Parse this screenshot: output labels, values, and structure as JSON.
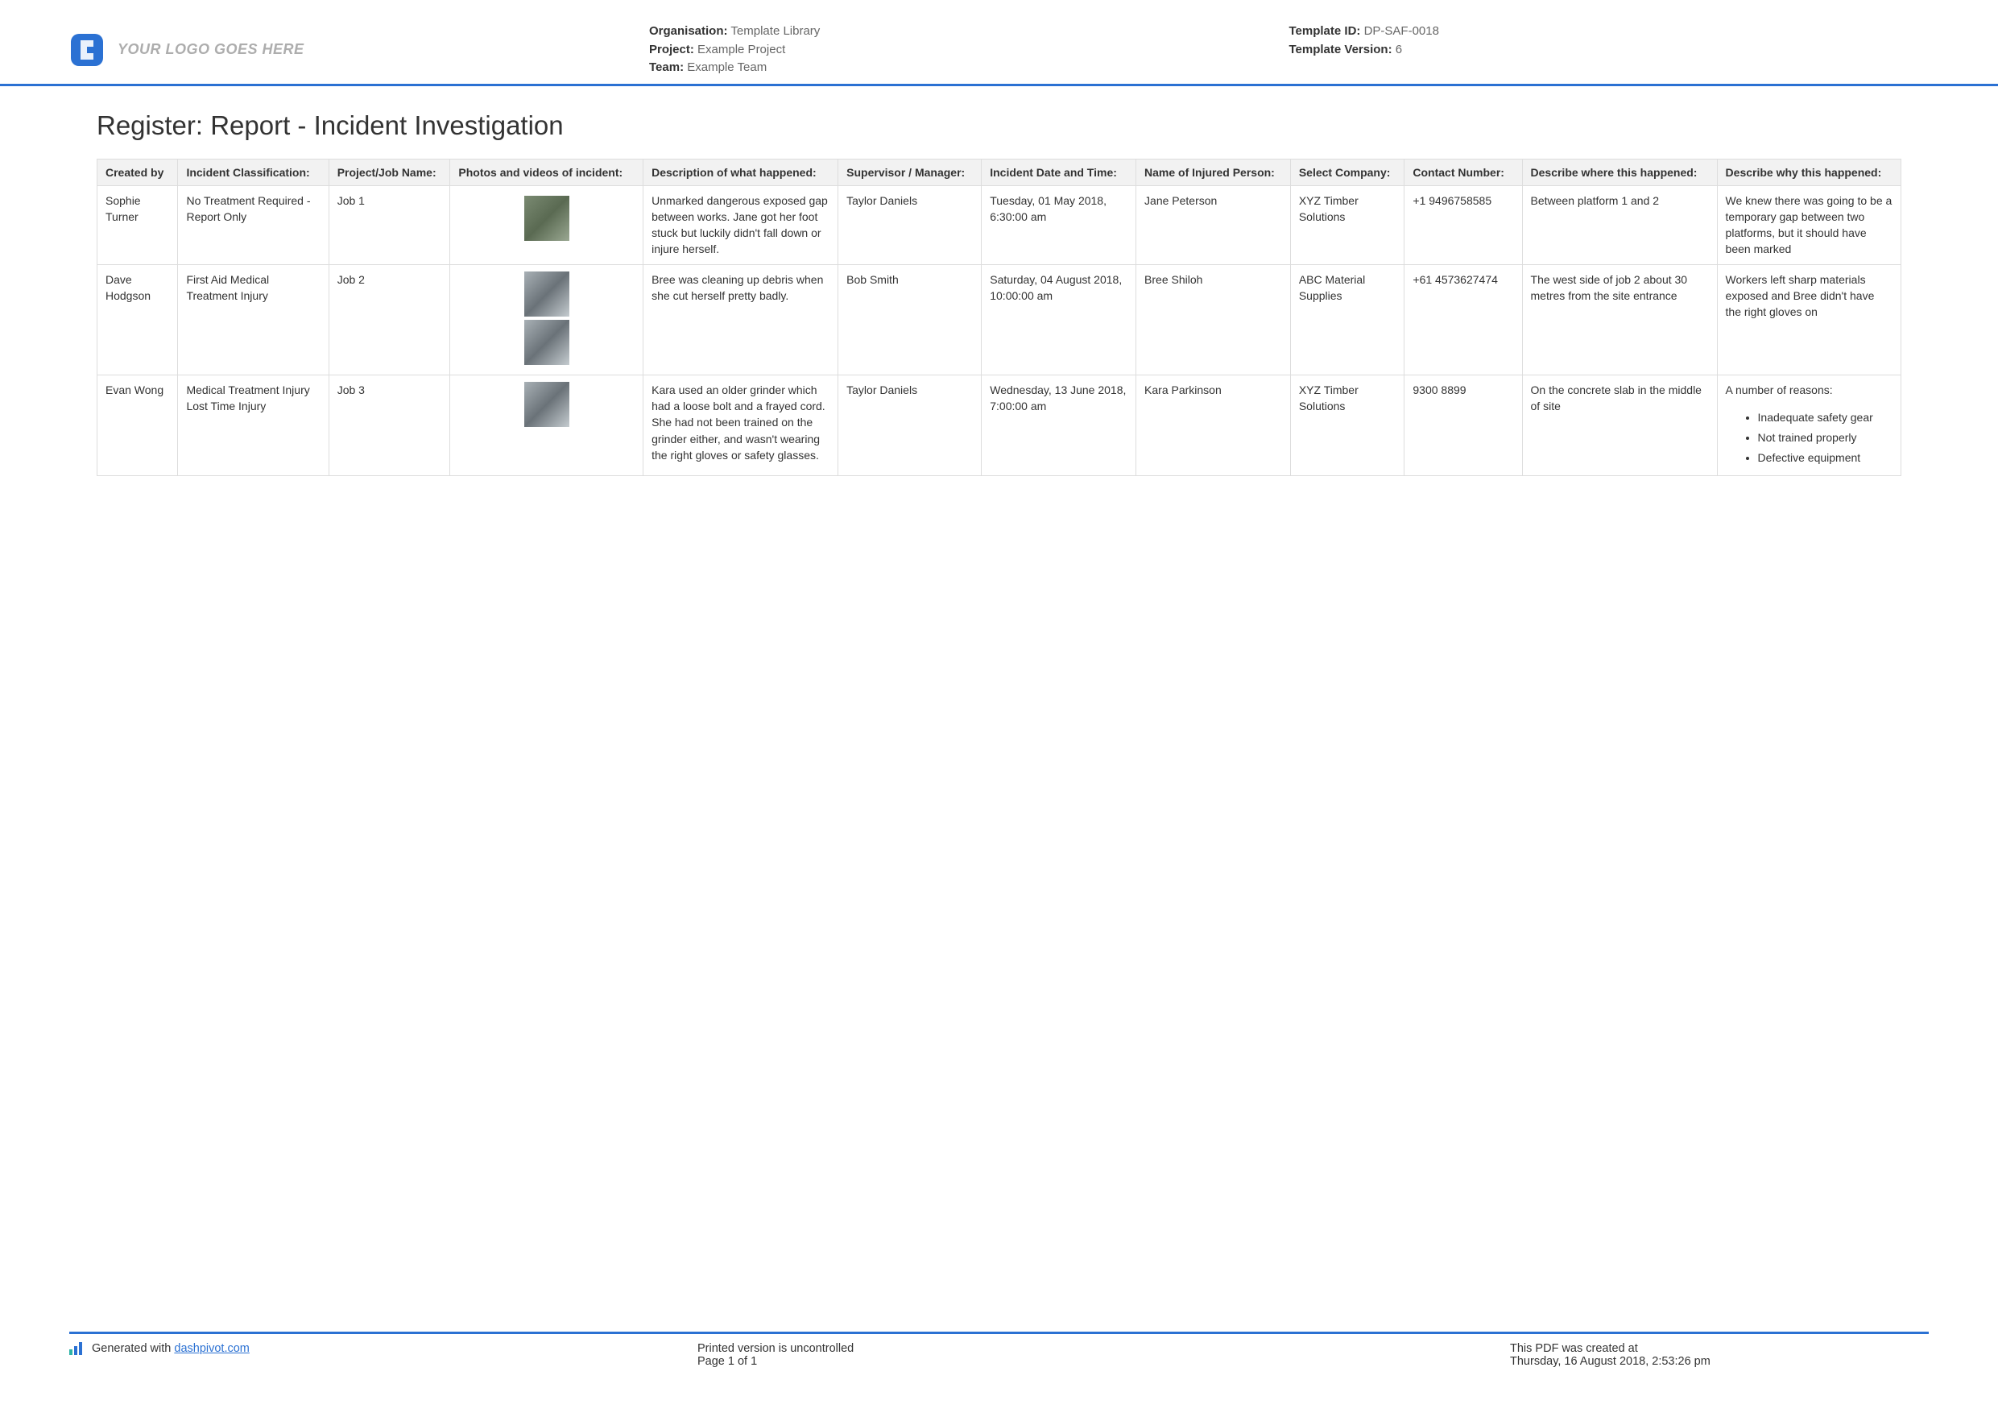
{
  "header": {
    "logo_text": "YOUR LOGO GOES HERE",
    "organisation_label": "Organisation:",
    "organisation_value": "Template Library",
    "project_label": "Project:",
    "project_value": "Example Project",
    "team_label": "Team:",
    "team_value": "Example Team",
    "template_id_label": "Template ID:",
    "template_id_value": "DP-SAF-0018",
    "template_version_label": "Template Version:",
    "template_version_value": "6"
  },
  "title": "Register: Report - Incident Investigation",
  "columns": {
    "created_by": "Created by",
    "classification": "Incident Classification:",
    "job": "Project/Job Name:",
    "photos": "Photos and videos of incident:",
    "description": "Description of what happened:",
    "supervisor": "Supervisor / Manager:",
    "date": "Incident Date and Time:",
    "injured": "Name of Injured Person:",
    "company": "Select Company:",
    "contact": "Contact Number:",
    "where": "Describe where this happened:",
    "why": "Describe why this happened:"
  },
  "rows": [
    {
      "created_by": "Sophie Turner",
      "classification": "No Treatment Required - Report Only",
      "job": "Job 1",
      "description": "Unmarked dangerous exposed gap between works. Jane got her foot stuck but luckily didn't fall down or injure herself.",
      "supervisor": "Taylor Daniels",
      "date": "Tuesday, 01 May 2018, 6:30:00 am",
      "injured": "Jane Peterson",
      "company": "XYZ Timber Solutions",
      "contact": "+1 9496758585",
      "where": "Between platform 1 and 2",
      "why": "We knew there was going to be a temporary gap between two platforms, but it should have been marked"
    },
    {
      "created_by": "Dave Hodgson",
      "classification": "First Aid    Medical Treatment Injury",
      "job": "Job 2",
      "description": "Bree was cleaning up debris when she cut herself pretty badly.",
      "supervisor": "Bob Smith",
      "date": "Saturday, 04 August 2018, 10:00:00 am",
      "injured": "Bree Shiloh",
      "company": "ABC Material Supplies",
      "contact": "+61 4573627474",
      "where": "The west side of job 2 about 30 metres from the site entrance",
      "why": "Workers left sharp materials exposed and Bree didn't have the right gloves on"
    },
    {
      "created_by": "Evan Wong",
      "classification": "Medical Treatment Injury    Lost Time Injury",
      "job": "Job 3",
      "description": "Kara used an older grinder which had a loose bolt and a frayed cord. She had not been trained on the grinder either, and wasn't wearing the right gloves or safety glasses.",
      "supervisor": "Taylor Daniels",
      "date": "Wednesday, 13 June 2018, 7:00:00 am",
      "injured": "Kara Parkinson",
      "company": "XYZ Timber Solutions",
      "contact": "9300 8899",
      "where": "On the concrete slab in the middle of site",
      "why_intro": "A number of reasons:",
      "why_list": [
        "Inadequate safety gear",
        "Not trained properly",
        "Defective equipment"
      ]
    }
  ],
  "footer": {
    "generated": "Generated with ",
    "link": "dashpivot.com",
    "printed": "Printed version is uncontrolled",
    "page": "Page 1 of 1",
    "pdf_created": "This PDF was created at",
    "pdf_date": "Thursday, 16 August 2018, 2:53:26 pm"
  }
}
